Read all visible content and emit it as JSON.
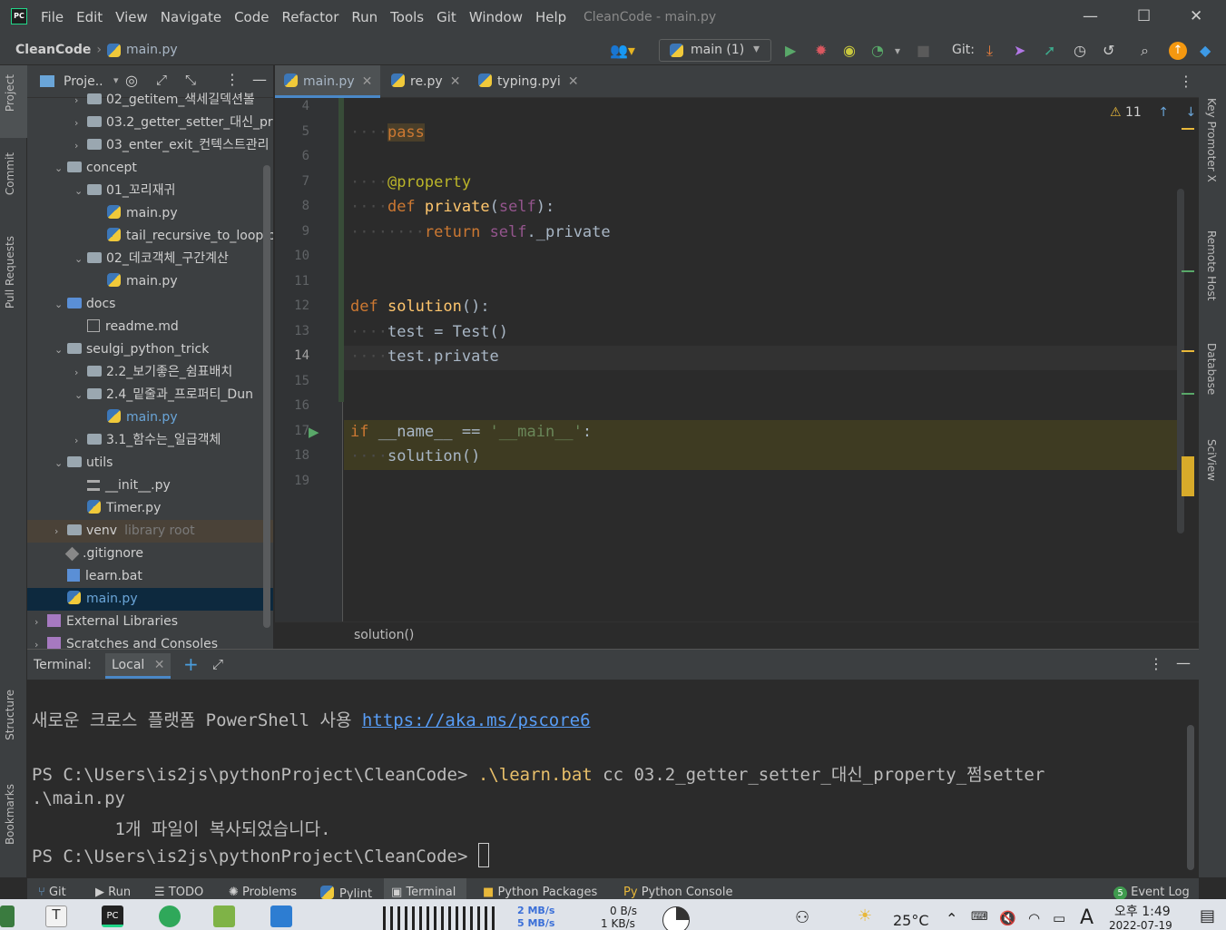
{
  "menubar": {
    "items": [
      "File",
      "Edit",
      "View",
      "Navigate",
      "Code",
      "Refactor",
      "Run",
      "Tools",
      "Git",
      "Window",
      "Help"
    ],
    "window_title": "CleanCode - main.py",
    "logo": "PC"
  },
  "navbar": {
    "project": "CleanCode",
    "file": "main.py",
    "branch": "main (1)",
    "git_label": "Git:"
  },
  "project_panel": {
    "title": "Proje..",
    "tree": [
      {
        "label": "02_getitem_색세길덱션볼",
        "indent": 2,
        "type": "folder",
        "expanded": false
      },
      {
        "label": "03.2_getter_setter_대신_pr",
        "indent": 2,
        "type": "folder",
        "expanded": false
      },
      {
        "label": "03_enter_exit_컨텍스트관리",
        "indent": 2,
        "type": "folder",
        "expanded": false
      },
      {
        "label": "concept",
        "indent": 1,
        "type": "folder",
        "expanded": true
      },
      {
        "label": "01_꼬리재귀",
        "indent": 2,
        "type": "folder",
        "expanded": true
      },
      {
        "label": "main.py",
        "indent": 3,
        "type": "py"
      },
      {
        "label": "tail_recursive_to_loop.p",
        "indent": 3,
        "type": "py"
      },
      {
        "label": "02_데코객체_구간계산",
        "indent": 2,
        "type": "folder",
        "expanded": true
      },
      {
        "label": "main.py",
        "indent": 3,
        "type": "py"
      },
      {
        "label": "docs",
        "indent": 1,
        "type": "folder",
        "expanded": true
      },
      {
        "label": "readme.md",
        "indent": 2,
        "type": "md"
      },
      {
        "label": "seulgi_python_trick",
        "indent": 1,
        "type": "folder",
        "expanded": true
      },
      {
        "label": "2.2_보기좋은_쉼표배치",
        "indent": 2,
        "type": "folder",
        "expanded": false
      },
      {
        "label": "2.4_밑줄과_프로퍼티_Dun",
        "indent": 2,
        "type": "folder",
        "expanded": true
      },
      {
        "label": "main.py",
        "indent": 3,
        "type": "py",
        "highlight": true
      },
      {
        "label": "3.1_함수는_일급객체",
        "indent": 2,
        "type": "folder",
        "expanded": false
      },
      {
        "label": "utils",
        "indent": 1,
        "type": "folder",
        "expanded": true
      },
      {
        "label": "__init__.py",
        "indent": 2,
        "type": "init"
      },
      {
        "label": "Timer.py",
        "indent": 2,
        "type": "py"
      },
      {
        "label": "venv",
        "indent": 1,
        "type": "folder",
        "expanded": false,
        "suffix": "library root"
      },
      {
        "label": ".gitignore",
        "indent": 1,
        "type": "git"
      },
      {
        "label": "learn.bat",
        "indent": 1,
        "type": "bat"
      },
      {
        "label": "main.py",
        "indent": 1,
        "type": "py",
        "selected": true
      },
      {
        "label": "External Libraries",
        "indent": 0,
        "type": "lib",
        "expanded": false
      },
      {
        "label": "Scratches and Consoles",
        "indent": 0,
        "type": "lib",
        "expanded": false
      }
    ]
  },
  "editor_tabs": [
    {
      "label": "main.py",
      "active": true
    },
    {
      "label": "re.py",
      "active": false
    },
    {
      "label": "typing.pyi",
      "active": false
    }
  ],
  "editor": {
    "warnings": "11",
    "current_line": 14,
    "lines": [
      {
        "n": "4",
        "html": ""
      },
      {
        "n": "5",
        "html": "<span class='dim'>····</span><span class='kw hl-pass'>pass</span>"
      },
      {
        "n": "6",
        "html": ""
      },
      {
        "n": "7",
        "html": "<span class='dim'>····</span><span class='deco'>@property</span>"
      },
      {
        "n": "8",
        "html": "<span class='dim'>····</span><span class='kw'>def</span> <span class='fn'>private</span>(<span class='selfc'>self</span>):"
      },
      {
        "n": "9",
        "html": "<span class='dim'>········</span><span class='kw'>return</span> <span class='selfc'>self</span>._private"
      },
      {
        "n": "10",
        "html": ""
      },
      {
        "n": "11",
        "html": ""
      },
      {
        "n": "12",
        "html": "<span class='kw'>def</span> <span class='fn'>solution</span>():"
      },
      {
        "n": "13",
        "html": "<span class='dim'>····</span>test = Test()"
      },
      {
        "n": "14",
        "html": "<span class='dim'>····</span>test.private"
      },
      {
        "n": "15",
        "html": ""
      },
      {
        "n": "16",
        "html": ""
      },
      {
        "n": "17",
        "html": "<span class='kw'>if</span> __name__ == <span class='str'>'__main__'</span>:"
      },
      {
        "n": "18",
        "html": "<span class='dim'>····</span>solution()"
      },
      {
        "n": "19",
        "html": ""
      }
    ],
    "breadcrumb": "solution()"
  },
  "terminal": {
    "label": "Terminal:",
    "tab": "Local",
    "line1_text": "새로운 크로스 플랫폼 PowerShell 사용 ",
    "line1_link": "https://aka.ms/pscore6",
    "prompt": "PS C:\\Users\\is2js\\pythonProject\\CleanCode> ",
    "command": ".\\learn.bat",
    "args": " cc 03.2_getter_setter_대신_property_쩜setter",
    "line3": ".\\main.py",
    "line4": "        1개 파일이 복사되었습니다.",
    "prompt2": "PS C:\\Users\\is2js\\pythonProject\\CleanCode> "
  },
  "left_tools": [
    "Project",
    "Commit",
    "Pull Requests",
    "Structure",
    "Bookmarks"
  ],
  "right_tools": [
    "Key Promoter X",
    "Remote Host",
    "Database",
    "SciView"
  ],
  "bottom_tools": [
    {
      "label": "Git"
    },
    {
      "label": "Run"
    },
    {
      "label": "TODO"
    },
    {
      "label": "Problems"
    },
    {
      "label": "Pylint"
    },
    {
      "label": "Terminal",
      "active": true
    },
    {
      "label": "Python Packages"
    },
    {
      "label": "Python Console"
    },
    {
      "label": "Event Log",
      "badge": "5"
    }
  ],
  "taskbar": {
    "net_up": "2 MB/s",
    "net_down": "5 MB/s",
    "disk_r": "0 B/s",
    "disk_w": "1 KB/s",
    "temp": "25°C",
    "ime": "A",
    "time": "오후 1:49",
    "date": "2022-07-19"
  }
}
